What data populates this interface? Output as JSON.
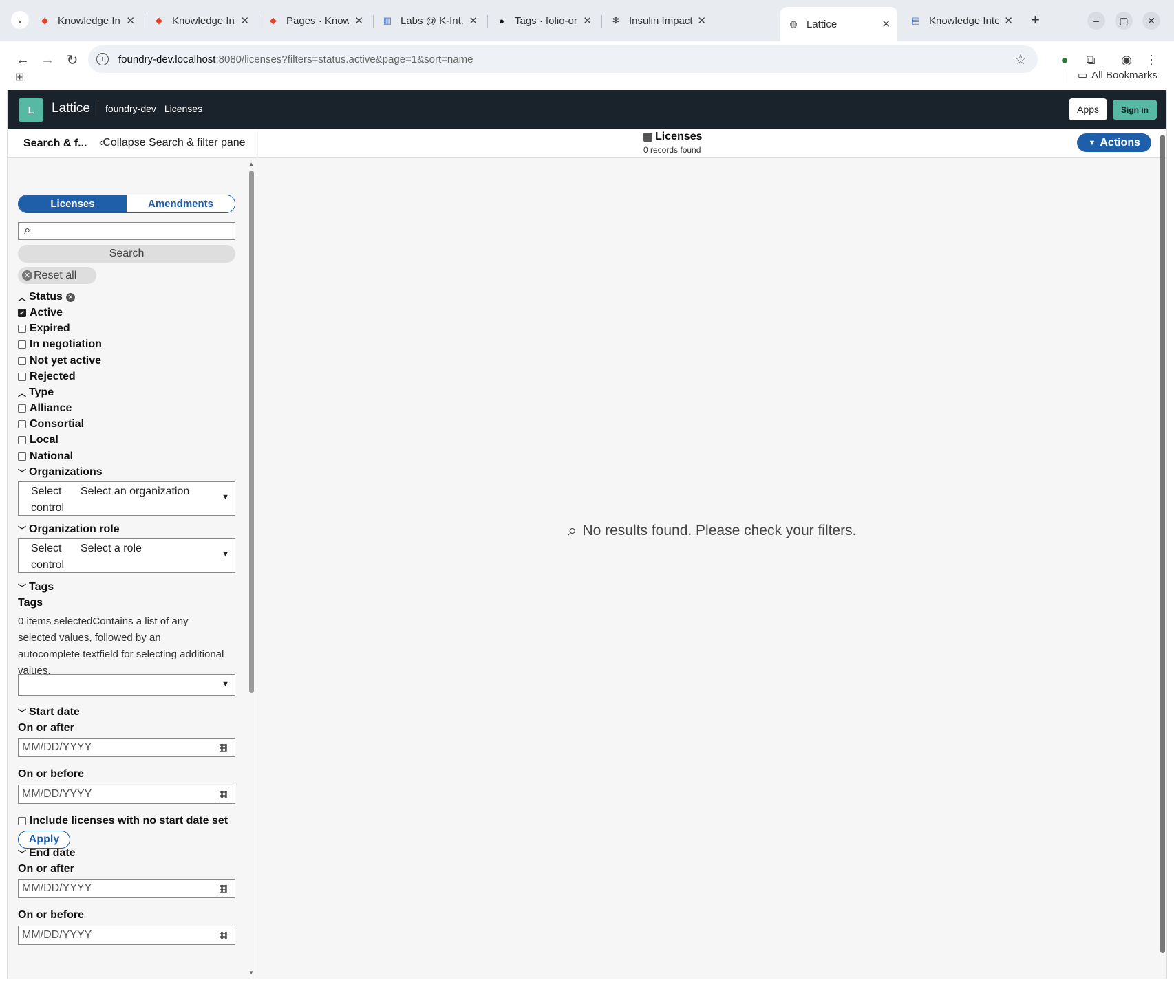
{
  "browser": {
    "tabs": [
      {
        "title": "Knowledge Inte",
        "icon": "gitlab-icon"
      },
      {
        "title": "Knowledge Inte",
        "icon": "gitlab-icon"
      },
      {
        "title": "Pages · Knowled",
        "icon": "gitlab-icon"
      },
      {
        "title": "Labs @ K-Int.con",
        "icon": "labs-icon"
      },
      {
        "title": "Tags · folio-org/",
        "icon": "github-icon"
      },
      {
        "title": "Insulin Impact o",
        "icon": "openai-icon"
      },
      {
        "title": "Lattice",
        "icon": "globe-icon"
      },
      {
        "title": "Knowledge Inte",
        "icon": "doc-icon"
      }
    ],
    "active_tab": 6,
    "url_host": "foundry-dev.localhost",
    "url_path": ":8080/licenses?filters=status.active&page=1&sort=name",
    "bookmarks_label": "All Bookmarks"
  },
  "app": {
    "logo_letter": "L",
    "name": "Lattice",
    "breadcrumbs": [
      "foundry-dev",
      "Licenses"
    ],
    "apps_label": "Apps",
    "signin_label": "Sign in"
  },
  "filter_pane": {
    "title": "Search & f...",
    "collapse_label": "Collapse Search & filter pane",
    "segments": [
      "Licenses",
      "Amendments"
    ],
    "active_segment": "Licenses",
    "search_value": "",
    "search_button": "Search",
    "reset_label": "Reset all",
    "status": {
      "heading": "Status",
      "options": [
        {
          "label": "Active",
          "checked": true
        },
        {
          "label": "Expired",
          "checked": false
        },
        {
          "label": "In negotiation",
          "checked": false
        },
        {
          "label": "Not yet active",
          "checked": false
        },
        {
          "label": "Rejected",
          "checked": false
        }
      ]
    },
    "type": {
      "heading": "Type",
      "options": [
        {
          "label": "Alliance",
          "checked": false
        },
        {
          "label": "Consortial",
          "checked": false
        },
        {
          "label": "Local",
          "checked": false
        },
        {
          "label": "National",
          "checked": false
        }
      ]
    },
    "organizations": {
      "heading": "Organizations",
      "select_label": "Select control",
      "placeholder": "Select an organization"
    },
    "organization_role": {
      "heading": "Organization role",
      "select_label": "Select control",
      "placeholder": "Select a role"
    },
    "tags": {
      "heading": "Tags",
      "label": "Tags",
      "help": "0 items selectedContains a list of any selected values, followed by an autocomplete textfield for selecting additional values."
    },
    "start_date": {
      "heading": "Start date",
      "after_label": "On or after",
      "before_label": "On or before",
      "placeholder": "MM/DD/YYYY",
      "no_date_label": "Include licenses with no start date set",
      "apply_label": "Apply"
    },
    "end_date": {
      "heading": "End date",
      "after_label": "On or after",
      "before_label": "On or before",
      "placeholder": "MM/DD/YYYY"
    }
  },
  "results": {
    "title": "Licenses",
    "count": "0 records found",
    "actions_label": "Actions",
    "empty_message": "No results found. Please check your filters."
  },
  "colors": {
    "header_bg": "#1a222c",
    "accent": "#57b8a4",
    "primary": "#1f5ea8"
  }
}
